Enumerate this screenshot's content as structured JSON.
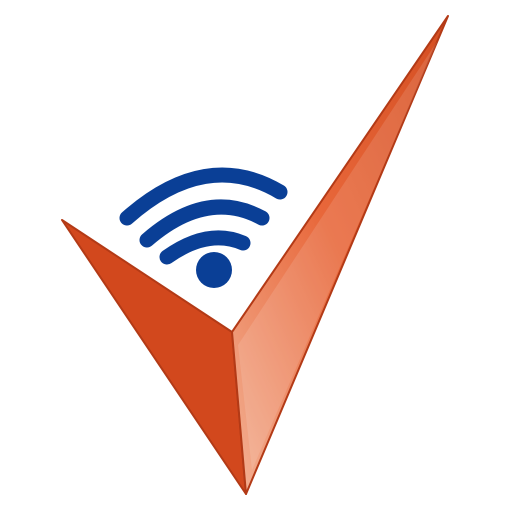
{
  "logo": {
    "name": "wifi-checkmark-logo",
    "icons": [
      "checkmark-icon",
      "wifi-icon"
    ]
  },
  "colors": {
    "background": "#ffffff",
    "check_light": "#f4a07a",
    "check_mid": "#e8673a",
    "check_dark": "#c9431b",
    "check_edge": "#b33a16",
    "wifi_blue": "#0a3f96"
  }
}
